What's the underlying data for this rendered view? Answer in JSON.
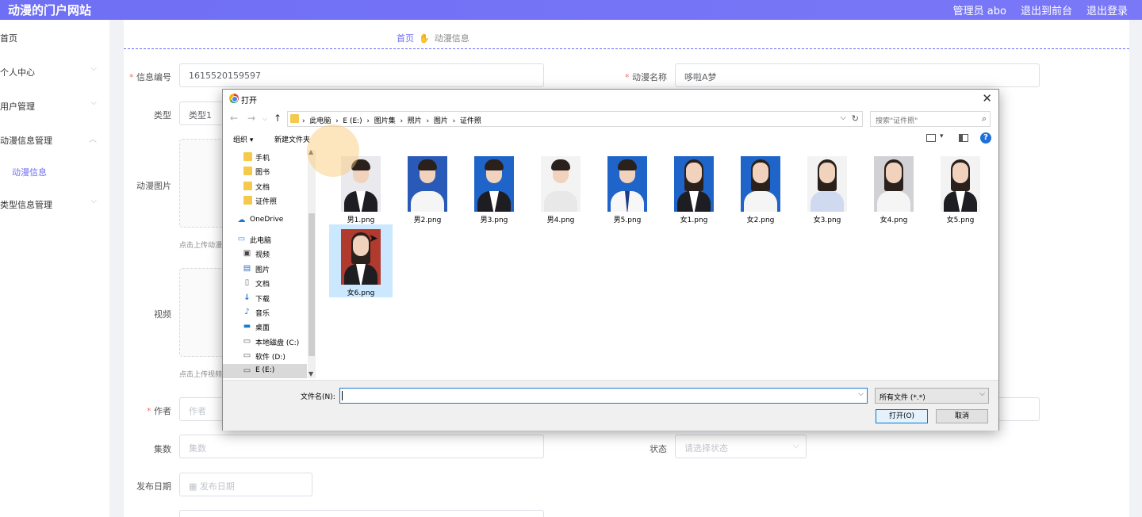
{
  "header": {
    "brand": "动漫的门户网站",
    "admin": "管理员 abo",
    "exit_front": "退出到前台",
    "logout": "退出登录"
  },
  "sidebar": {
    "items": [
      {
        "label": "首页"
      },
      {
        "label": "个人中心"
      },
      {
        "label": "用户管理"
      },
      {
        "label": "动漫信息管理"
      },
      {
        "label": "动漫信息"
      },
      {
        "label": "类型信息管理"
      }
    ]
  },
  "breadcrumb": {
    "home": "首页",
    "current": "动漫信息"
  },
  "form": {
    "info_no_label": "信息编号",
    "info_no_value": "1615520159597",
    "name_label": "动漫名称",
    "name_value": "哆啦A梦",
    "type_label": "类型",
    "type_value": "类型1",
    "image_label": "动漫图片",
    "image_hint": "点击上传动漫",
    "video_label": "视频",
    "video_hint": "点击上传视频",
    "author_label": "作者",
    "author_placeholder": "作者",
    "episodes_label": "集数",
    "episodes_placeholder": "集数",
    "status_label": "状态",
    "status_placeholder": "请选择状态",
    "date_label": "发布日期",
    "date_placeholder": "发布日期"
  },
  "dialog": {
    "title": "打开",
    "path": [
      "此电脑",
      "E (E:)",
      "图片集",
      "照片",
      "图片",
      "证件照"
    ],
    "search_placeholder": "搜索\"证件照\"",
    "organize": "组织 ▾",
    "new_folder": "新建文件夹",
    "help": "?",
    "nav_items": [
      {
        "label": "手机",
        "icon": "folder-icon"
      },
      {
        "label": "图书",
        "icon": "folder-icon"
      },
      {
        "label": "文档",
        "icon": "folder-icon"
      },
      {
        "label": "证件照",
        "icon": "folder-icon"
      },
      {
        "label": "OneDrive",
        "icon": "cloud-icon"
      },
      {
        "label": "此电脑",
        "icon": "computer-icon"
      },
      {
        "label": "视频",
        "icon": "video-icon"
      },
      {
        "label": "图片",
        "icon": "picture-icon"
      },
      {
        "label": "文档",
        "icon": "document-icon"
      },
      {
        "label": "下载",
        "icon": "download-icon"
      },
      {
        "label": "音乐",
        "icon": "music-icon"
      },
      {
        "label": "桌面",
        "icon": "desktop-icon"
      },
      {
        "label": "本地磁盘 (C:)",
        "icon": "drive-icon"
      },
      {
        "label": "软件 (D:)",
        "icon": "drive-icon"
      },
      {
        "label": "E (E:)",
        "icon": "drive-icon"
      }
    ],
    "files": [
      {
        "name": "男1.png",
        "bg": "#e9e9ee"
      },
      {
        "name": "男2.png",
        "bg": "#2a5ab8"
      },
      {
        "name": "男3.png",
        "bg": "#1f64c8"
      },
      {
        "name": "男4.png",
        "bg": "#f3f3f3"
      },
      {
        "name": "男5.png",
        "bg": "#1f64c8"
      },
      {
        "name": "女1.png",
        "bg": "#1f64c8"
      },
      {
        "name": "女2.png",
        "bg": "#1f64c8"
      },
      {
        "name": "女3.png",
        "bg": "#f3f3f3"
      },
      {
        "name": "女4.png",
        "bg": "#d2d2d6"
      },
      {
        "name": "女5.png",
        "bg": "#f3f3f3"
      },
      {
        "name": "女6.png",
        "bg": "#b03a2e"
      }
    ],
    "filename_label": "文件名(N):",
    "filename_value": "",
    "filetype": "所有文件 (*.*)",
    "open_button": "打开(O)",
    "cancel_button": "取消"
  },
  "colors": {
    "accent": "#6f6ff5",
    "required": "#f56c6c",
    "selection": "#cce8ff"
  }
}
